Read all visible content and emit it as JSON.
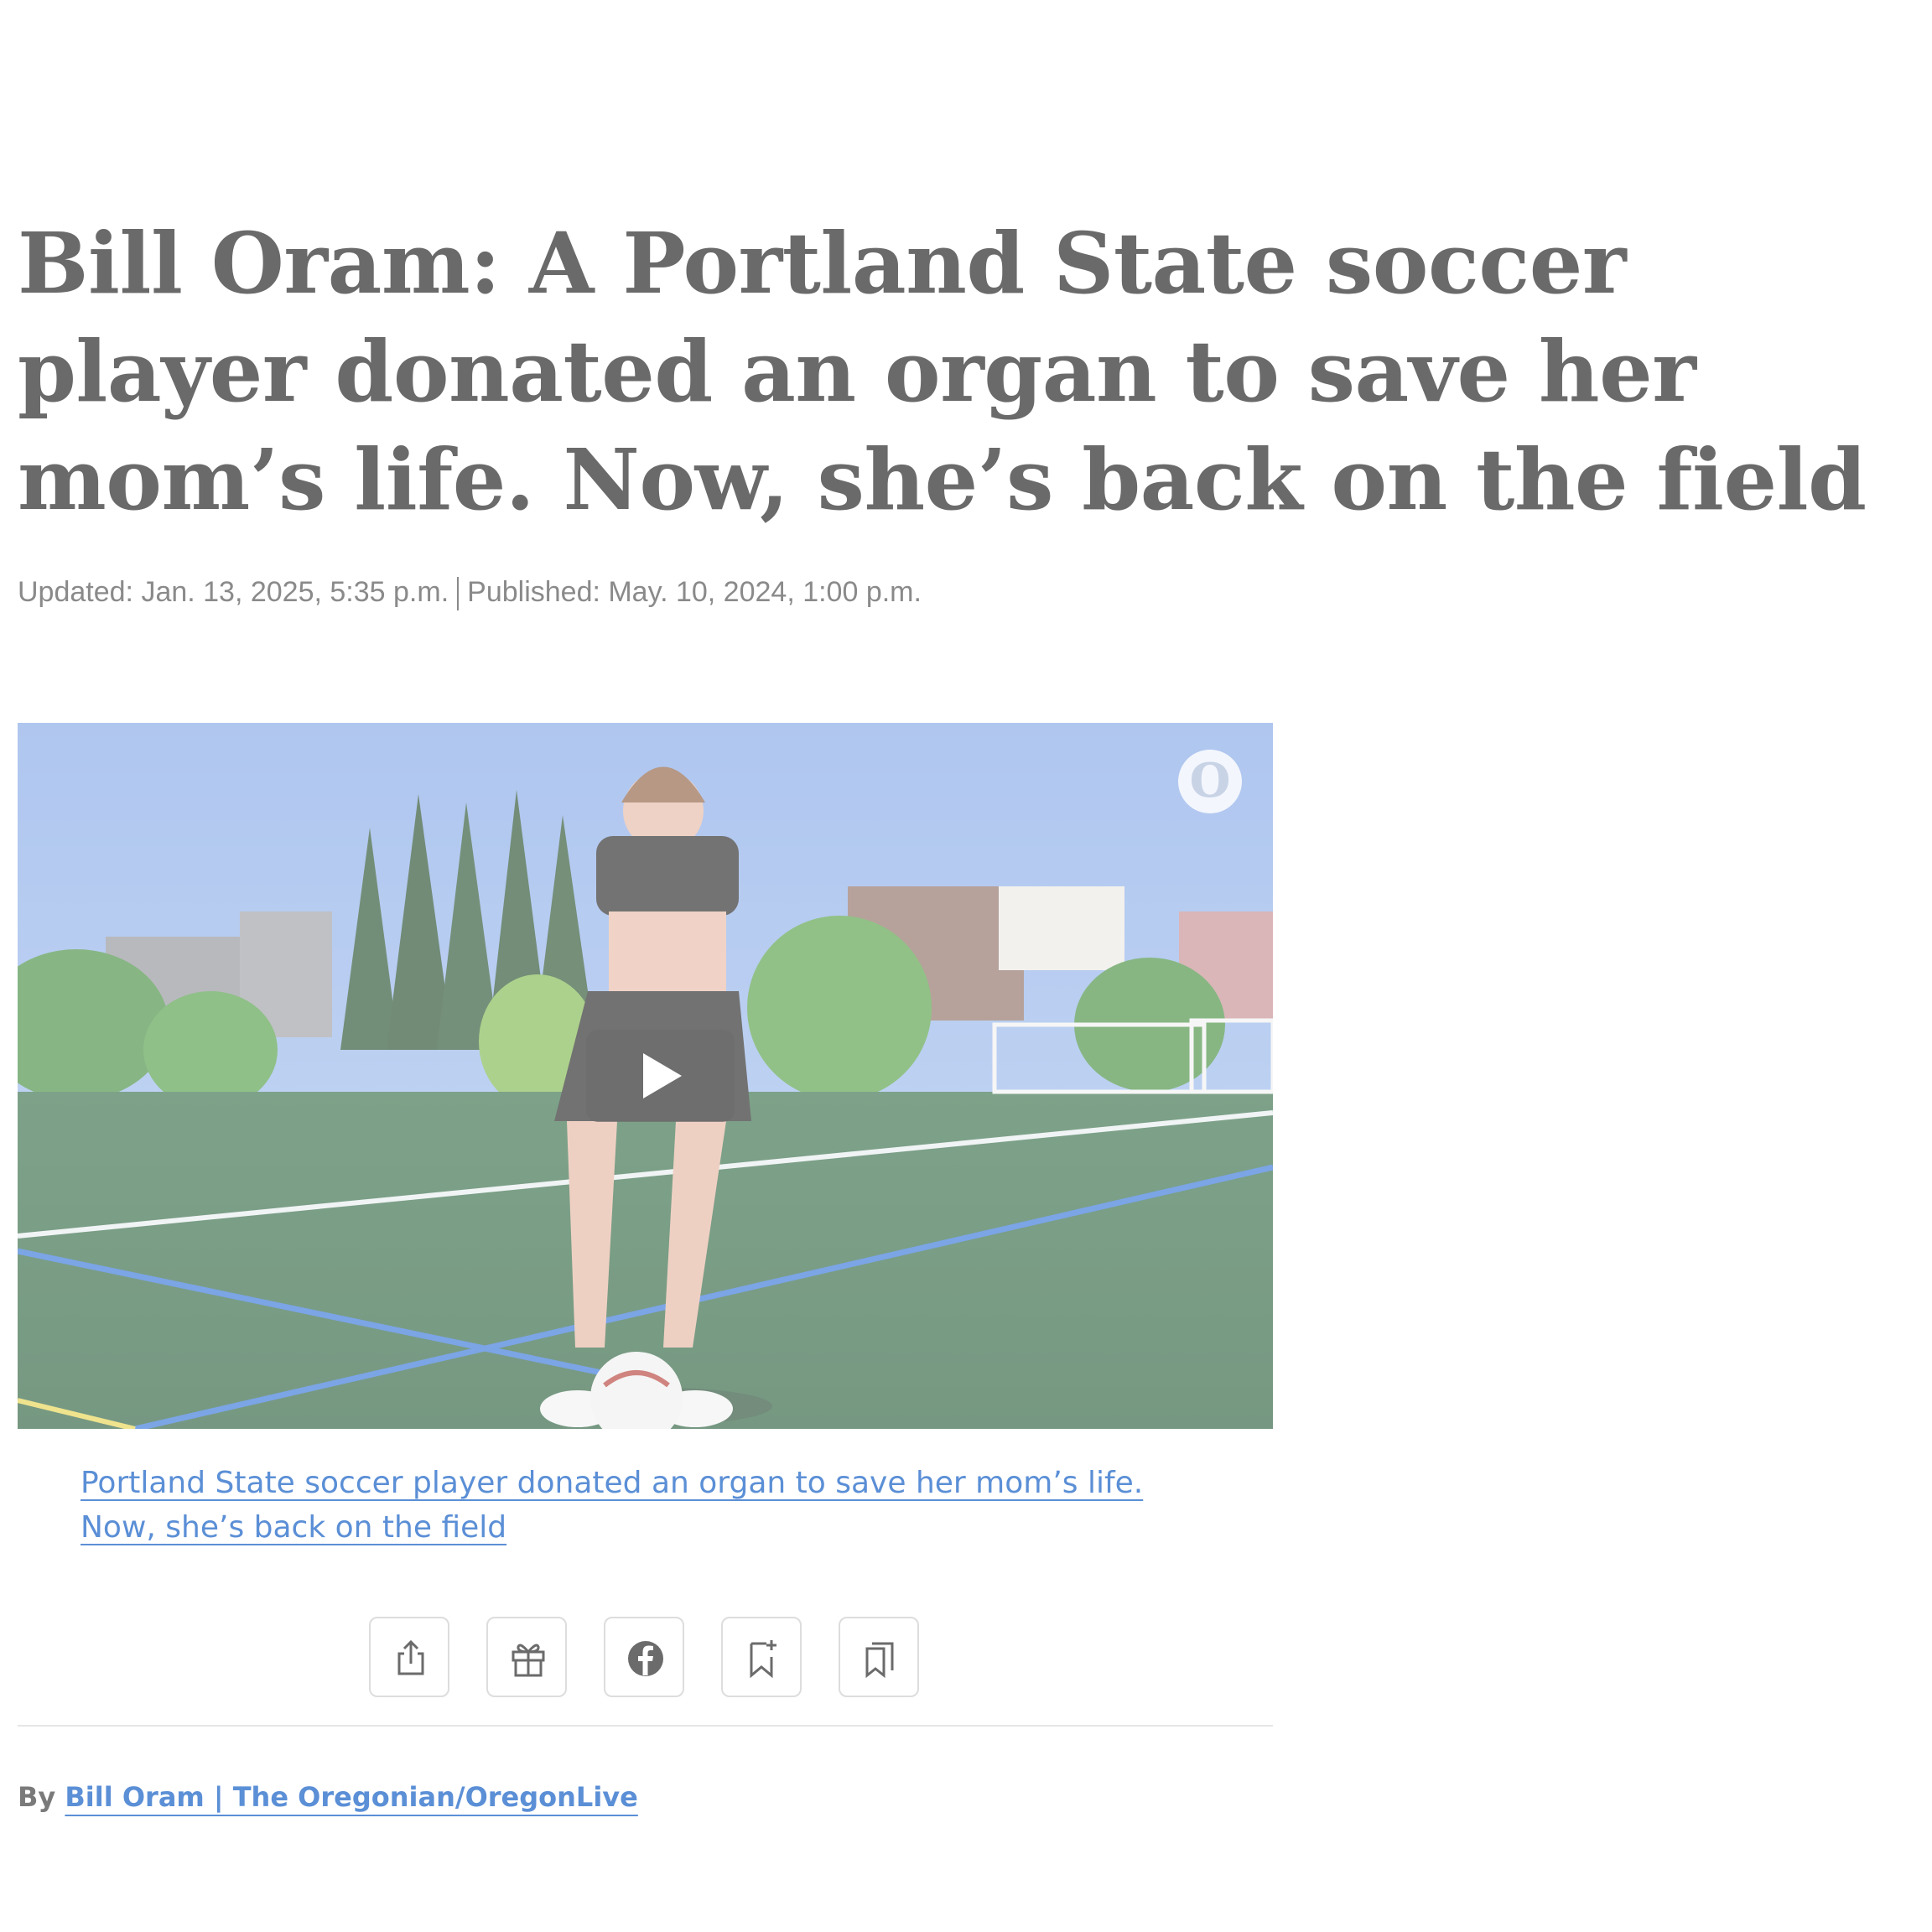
{
  "article": {
    "headline": "Bill Oram: A Portland State soccer player donated an organ to save her mom’s life. Now, she’s back on the field",
    "updated": "Updated: Jan. 13, 2025, 5:35 p.m.",
    "published": "Published: May. 10, 2024, 1:00 p.m."
  },
  "video": {
    "logo_letter": "O",
    "play_icon": "play-icon",
    "caption_link": "Portland State soccer player donated an organ to save her mom’s life. Now, she’s back on the field"
  },
  "share_bar": {
    "buttons": [
      {
        "icon": "share-icon"
      },
      {
        "icon": "gift-icon"
      },
      {
        "icon": "facebook-icon"
      },
      {
        "icon": "bookmark-add-icon"
      },
      {
        "icon": "bookmarks-icon"
      }
    ]
  },
  "byline": {
    "prefix": "By",
    "author": "Bill Oram | The Oregonian/OregonLive"
  },
  "colors": {
    "link": "#5b8fd6",
    "headline": "#6a6a6a",
    "meta": "#8a8a8a",
    "divider": "#e6e6e6"
  }
}
